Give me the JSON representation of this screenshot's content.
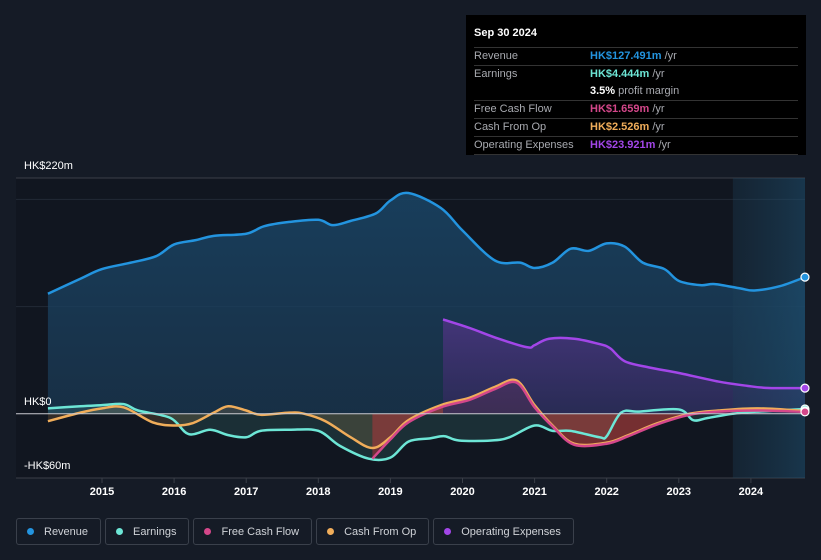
{
  "tooltip": {
    "date": "Sep 30 2024",
    "rows": [
      {
        "label": "Revenue",
        "value": "HK$127.491m",
        "unit": "/yr",
        "color": "#2394df"
      },
      {
        "label": "Earnings",
        "value": "HK$4.444m",
        "unit": "/yr",
        "color": "#6de6d6"
      },
      {
        "label": "",
        "value": "3.5%",
        "unit": "profit margin",
        "color": "#ffffff"
      },
      {
        "label": "Free Cash Flow",
        "value": "HK$1.659m",
        "unit": "/yr",
        "color": "#d4478a"
      },
      {
        "label": "Cash From Op",
        "value": "HK$2.526m",
        "unit": "/yr",
        "color": "#f0ad5a"
      },
      {
        "label": "Operating Expenses",
        "value": "HK$23.921m",
        "unit": "/yr",
        "color": "#a246e8"
      }
    ]
  },
  "legend": [
    {
      "label": "Revenue",
      "color": "#2394df"
    },
    {
      "label": "Earnings",
      "color": "#6de6d6"
    },
    {
      "label": "Free Cash Flow",
      "color": "#d4478a"
    },
    {
      "label": "Cash From Op",
      "color": "#f0ad5a"
    },
    {
      "label": "Operating Expenses",
      "color": "#a246e8"
    }
  ],
  "chart_data": {
    "type": "area",
    "title": "",
    "xlabel": "",
    "ylabel": "",
    "ylim": [
      -60,
      220
    ],
    "xlim": [
      2014.0,
      2024.75
    ],
    "unit": "HK$m",
    "y_tick_labels": [
      {
        "value": 220,
        "label": "HK$220m"
      },
      {
        "value": 0,
        "label": "HK$0"
      },
      {
        "value": -60,
        "label": "-HK$60m"
      }
    ],
    "x_ticks": [
      2015,
      2016,
      2017,
      2018,
      2019,
      2020,
      2021,
      2022,
      2023,
      2024
    ],
    "x_tick_labels": [
      "2015",
      "2016",
      "2017",
      "2018",
      "2019",
      "2020",
      "2021",
      "2022",
      "2023",
      "2024"
    ],
    "highlight_from": 2023.75,
    "grid": true,
    "legend_position": "bottom",
    "series": [
      {
        "name": "Revenue",
        "color": "#2394df",
        "x": [
          2014.25,
          2014.7,
          2015,
          2015.4,
          2015.75,
          2016,
          2016.3,
          2016.55,
          2017,
          2017.25,
          2017.6,
          2018,
          2018.2,
          2018.45,
          2018.8,
          2019,
          2019.25,
          2019.7,
          2020,
          2020.45,
          2020.8,
          2021,
          2021.25,
          2021.5,
          2021.75,
          2022,
          2022.25,
          2022.5,
          2022.8,
          2023,
          2023.3,
          2023.5,
          2023.85,
          2024.05,
          2024.4,
          2024.75
        ],
        "values": [
          112,
          126,
          135,
          141,
          147,
          158,
          162,
          166,
          168,
          175,
          179,
          181,
          176,
          180,
          187,
          199,
          206,
          192,
          171,
          143,
          141,
          136,
          141,
          154,
          152,
          159,
          156,
          141,
          135,
          124,
          120,
          121,
          117,
          115,
          119,
          127.5
        ]
      },
      {
        "name": "Earnings",
        "color": "#6de6d6",
        "x": [
          2014.25,
          2014.7,
          2015,
          2015.3,
          2015.5,
          2015.95,
          2016.2,
          2016.5,
          2016.75,
          2017,
          2017.2,
          2017.6,
          2018,
          2018.3,
          2018.7,
          2019,
          2019.25,
          2019.55,
          2019.75,
          2019.95,
          2020.4,
          2020.65,
          2021,
          2021.25,
          2021.5,
          2021.9,
          2022,
          2022.2,
          2022.45,
          2023,
          2023.2,
          2023.4,
          2023.75,
          2024.1,
          2024.75
        ],
        "values": [
          5,
          7,
          8,
          9,
          3,
          -4,
          -19,
          -15,
          -20,
          -22,
          -16,
          -15,
          -16,
          -30,
          -42,
          -41,
          -26,
          -23,
          -21,
          -25,
          -25,
          -22,
          -11,
          -16,
          -16,
          -22,
          -21,
          1,
          2,
          4,
          -6,
          -4,
          0,
          2,
          4.4
        ]
      },
      {
        "name": "Cash From Op",
        "color": "#f0ad5a",
        "x": [
          2014.25,
          2014.7,
          2015,
          2015.3,
          2015.7,
          2016,
          2016.25,
          2016.55,
          2016.75,
          2017,
          2017.2,
          2017.6,
          2017.8,
          2018.1,
          2018.45,
          2018.75,
          2019,
          2019.25,
          2019.7,
          2020.1,
          2020.45,
          2020.75,
          2021,
          2021.25,
          2021.55,
          2022,
          2022.3,
          2022.7,
          2023.15,
          2023.55,
          2024.1,
          2024.75
        ],
        "values": [
          -7,
          1,
          5,
          6,
          -8,
          -11,
          -9,
          1,
          7,
          3,
          -1,
          1,
          0,
          -7,
          -22,
          -32,
          -22,
          -6,
          8,
          15,
          25,
          31,
          8,
          -11,
          -28,
          -27,
          -20,
          -9,
          0,
          3,
          5,
          2.5
        ]
      },
      {
        "name": "Free Cash Flow",
        "color": "#d4478a",
        "x": [
          2018.75,
          2019,
          2019.25,
          2019.7,
          2020.1,
          2020.45,
          2020.75,
          2021,
          2021.25,
          2021.55,
          2022,
          2022.3,
          2022.7,
          2023.15,
          2023.55,
          2024.1,
          2024.75
        ],
        "values": [
          -42,
          -24,
          -8,
          6,
          13,
          23,
          29,
          6,
          -12,
          -29,
          -28,
          -21,
          -10,
          -1,
          2,
          3,
          1.7
        ]
      },
      {
        "name": "Operating Expenses",
        "color": "#a246e8",
        "x": [
          2019.73,
          2020.1,
          2020.5,
          2020.9,
          2021,
          2021.2,
          2021.55,
          2021.9,
          2022.05,
          2022.25,
          2022.6,
          2023,
          2023.55,
          2023.95,
          2024.25,
          2024.75
        ],
        "values": [
          88,
          80,
          70,
          62,
          64,
          70,
          70,
          65,
          61,
          49,
          43,
          38,
          30,
          26,
          24,
          23.9
        ]
      }
    ]
  }
}
